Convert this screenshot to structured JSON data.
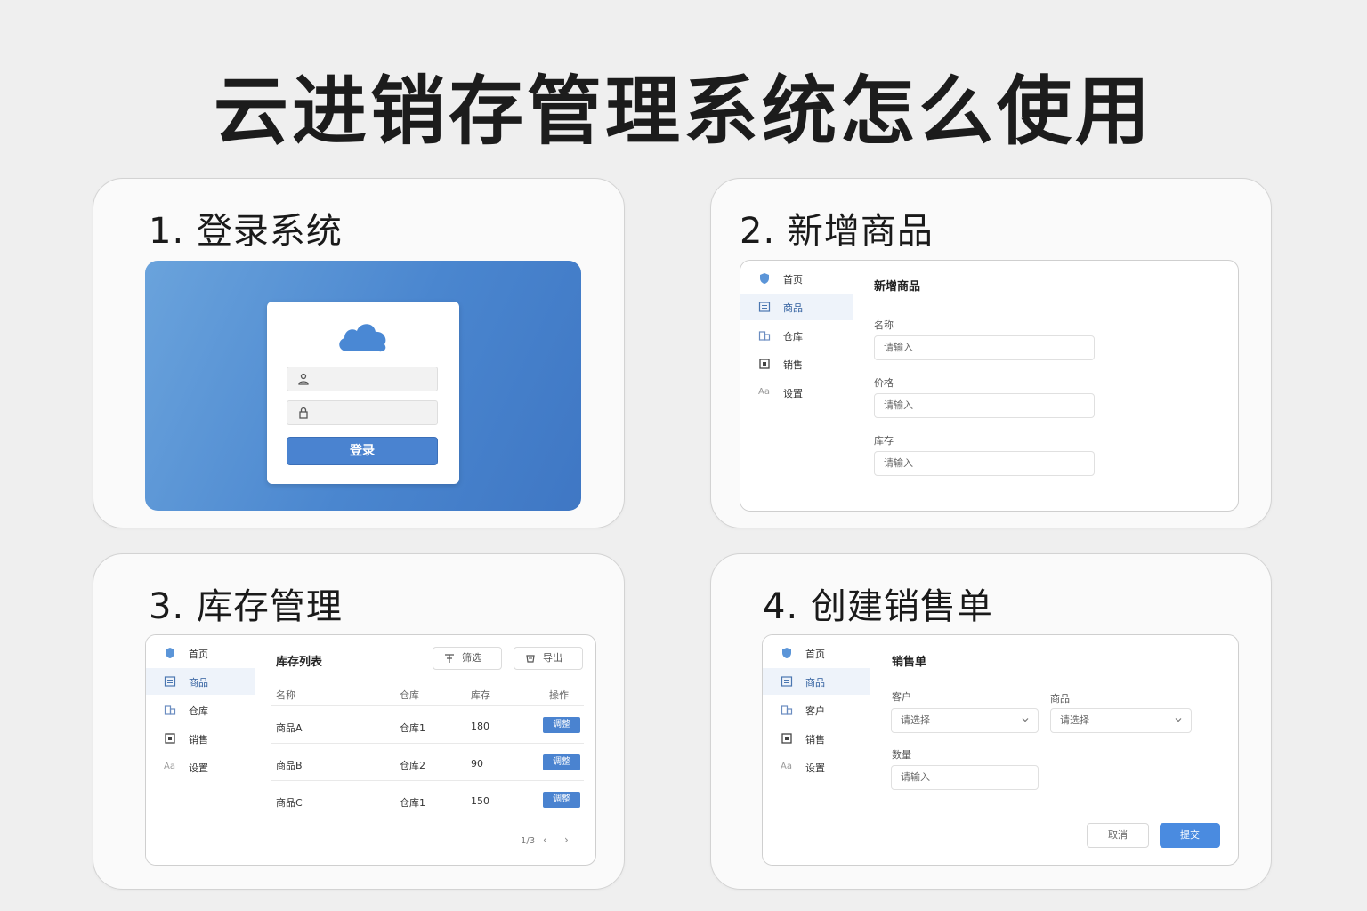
{
  "page_title": "云进销存管理系统怎么使用",
  "steps": [
    {
      "title": "1. 登录系统",
      "login": {
        "username_icon": "user-icon",
        "password_icon": "lock-icon",
        "button_label": "登录"
      }
    },
    {
      "title": "2. 新增商品",
      "sidebar": [
        {
          "icon": "shield-icon",
          "label": "首页"
        },
        {
          "icon": "list-icon",
          "label": "商品"
        },
        {
          "icon": "building-icon",
          "label": "仓库"
        },
        {
          "icon": "calendar-icon",
          "label": "销售"
        },
        {
          "icon": "font-icon",
          "label": "设置"
        }
      ],
      "form_heading": "新增商品",
      "fields": [
        {
          "label": "名称",
          "placeholder": "请输入"
        },
        {
          "label": "价格",
          "placeholder": "请输入"
        },
        {
          "label": "库存",
          "placeholder": "请输入"
        }
      ]
    },
    {
      "title": "3. 库存管理",
      "sidebar": [
        {
          "icon": "shield-icon",
          "label": "首页"
        },
        {
          "icon": "list-icon",
          "label": "商品"
        },
        {
          "icon": "building-icon",
          "label": "仓库"
        },
        {
          "icon": "calendar-icon",
          "label": "销售"
        },
        {
          "icon": "font-icon",
          "label": "设置"
        }
      ],
      "list_heading": "库存列表",
      "filter_label": "筛选",
      "export_label": "导出",
      "columns": [
        "名称",
        "仓库",
        "库存",
        "操作"
      ],
      "rows": [
        {
          "name": "商品A",
          "warehouse": "仓库1",
          "stock": "180",
          "action": "调整"
        },
        {
          "name": "商品B",
          "warehouse": "仓库2",
          "stock": "90",
          "action": "调整"
        },
        {
          "name": "商品C",
          "warehouse": "仓库1",
          "stock": "150",
          "action": "调整"
        }
      ],
      "pagination": "1/3"
    },
    {
      "title": "4. 创建销售单",
      "sidebar": [
        {
          "icon": "shield-icon",
          "label": "首页"
        },
        {
          "icon": "list-icon",
          "label": "商品"
        },
        {
          "icon": "building-icon",
          "label": "客户"
        },
        {
          "icon": "calendar-icon",
          "label": "销售"
        },
        {
          "icon": "font-icon",
          "label": "设置"
        }
      ],
      "form_heading": "销售单",
      "customer_label": "客户",
      "customer_value": "请选择",
      "product_label": "商品",
      "product_value": "请选择",
      "qty_label": "数量",
      "qty_placeholder": "请输入",
      "cancel_label": "取消",
      "submit_label": "提交"
    }
  ],
  "colors": {
    "accent": "#4a83d0",
    "login_gradient_start": "#6aa3dc",
    "login_gradient_end": "#3f77c4"
  }
}
